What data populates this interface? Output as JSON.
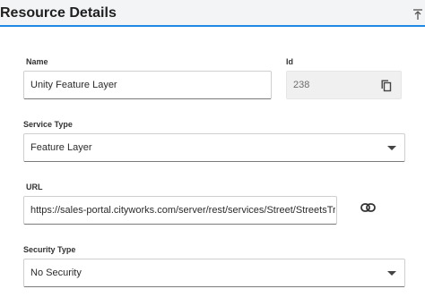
{
  "header": {
    "title": "Resource Details",
    "collapse_icon": "collapse-up-icon"
  },
  "fields": {
    "name": {
      "label": "Name",
      "value": "Unity Feature Layer"
    },
    "id": {
      "label": "Id",
      "value": "238",
      "icon": "copy-icon"
    },
    "service_type": {
      "label": "Service Type",
      "value": "Feature Layer"
    },
    "url": {
      "label": "URL",
      "value": "https://sales-portal.cityworks.com/server/rest/services/Street/StreetsTraffic/",
      "icon": "link-icon"
    },
    "security_type": {
      "label": "Security Type",
      "value": "No Security"
    }
  },
  "colors": {
    "accent": "#1e88e5",
    "header_bg": "#f3f4f6",
    "readonly_bg": "#f0f0f0"
  }
}
